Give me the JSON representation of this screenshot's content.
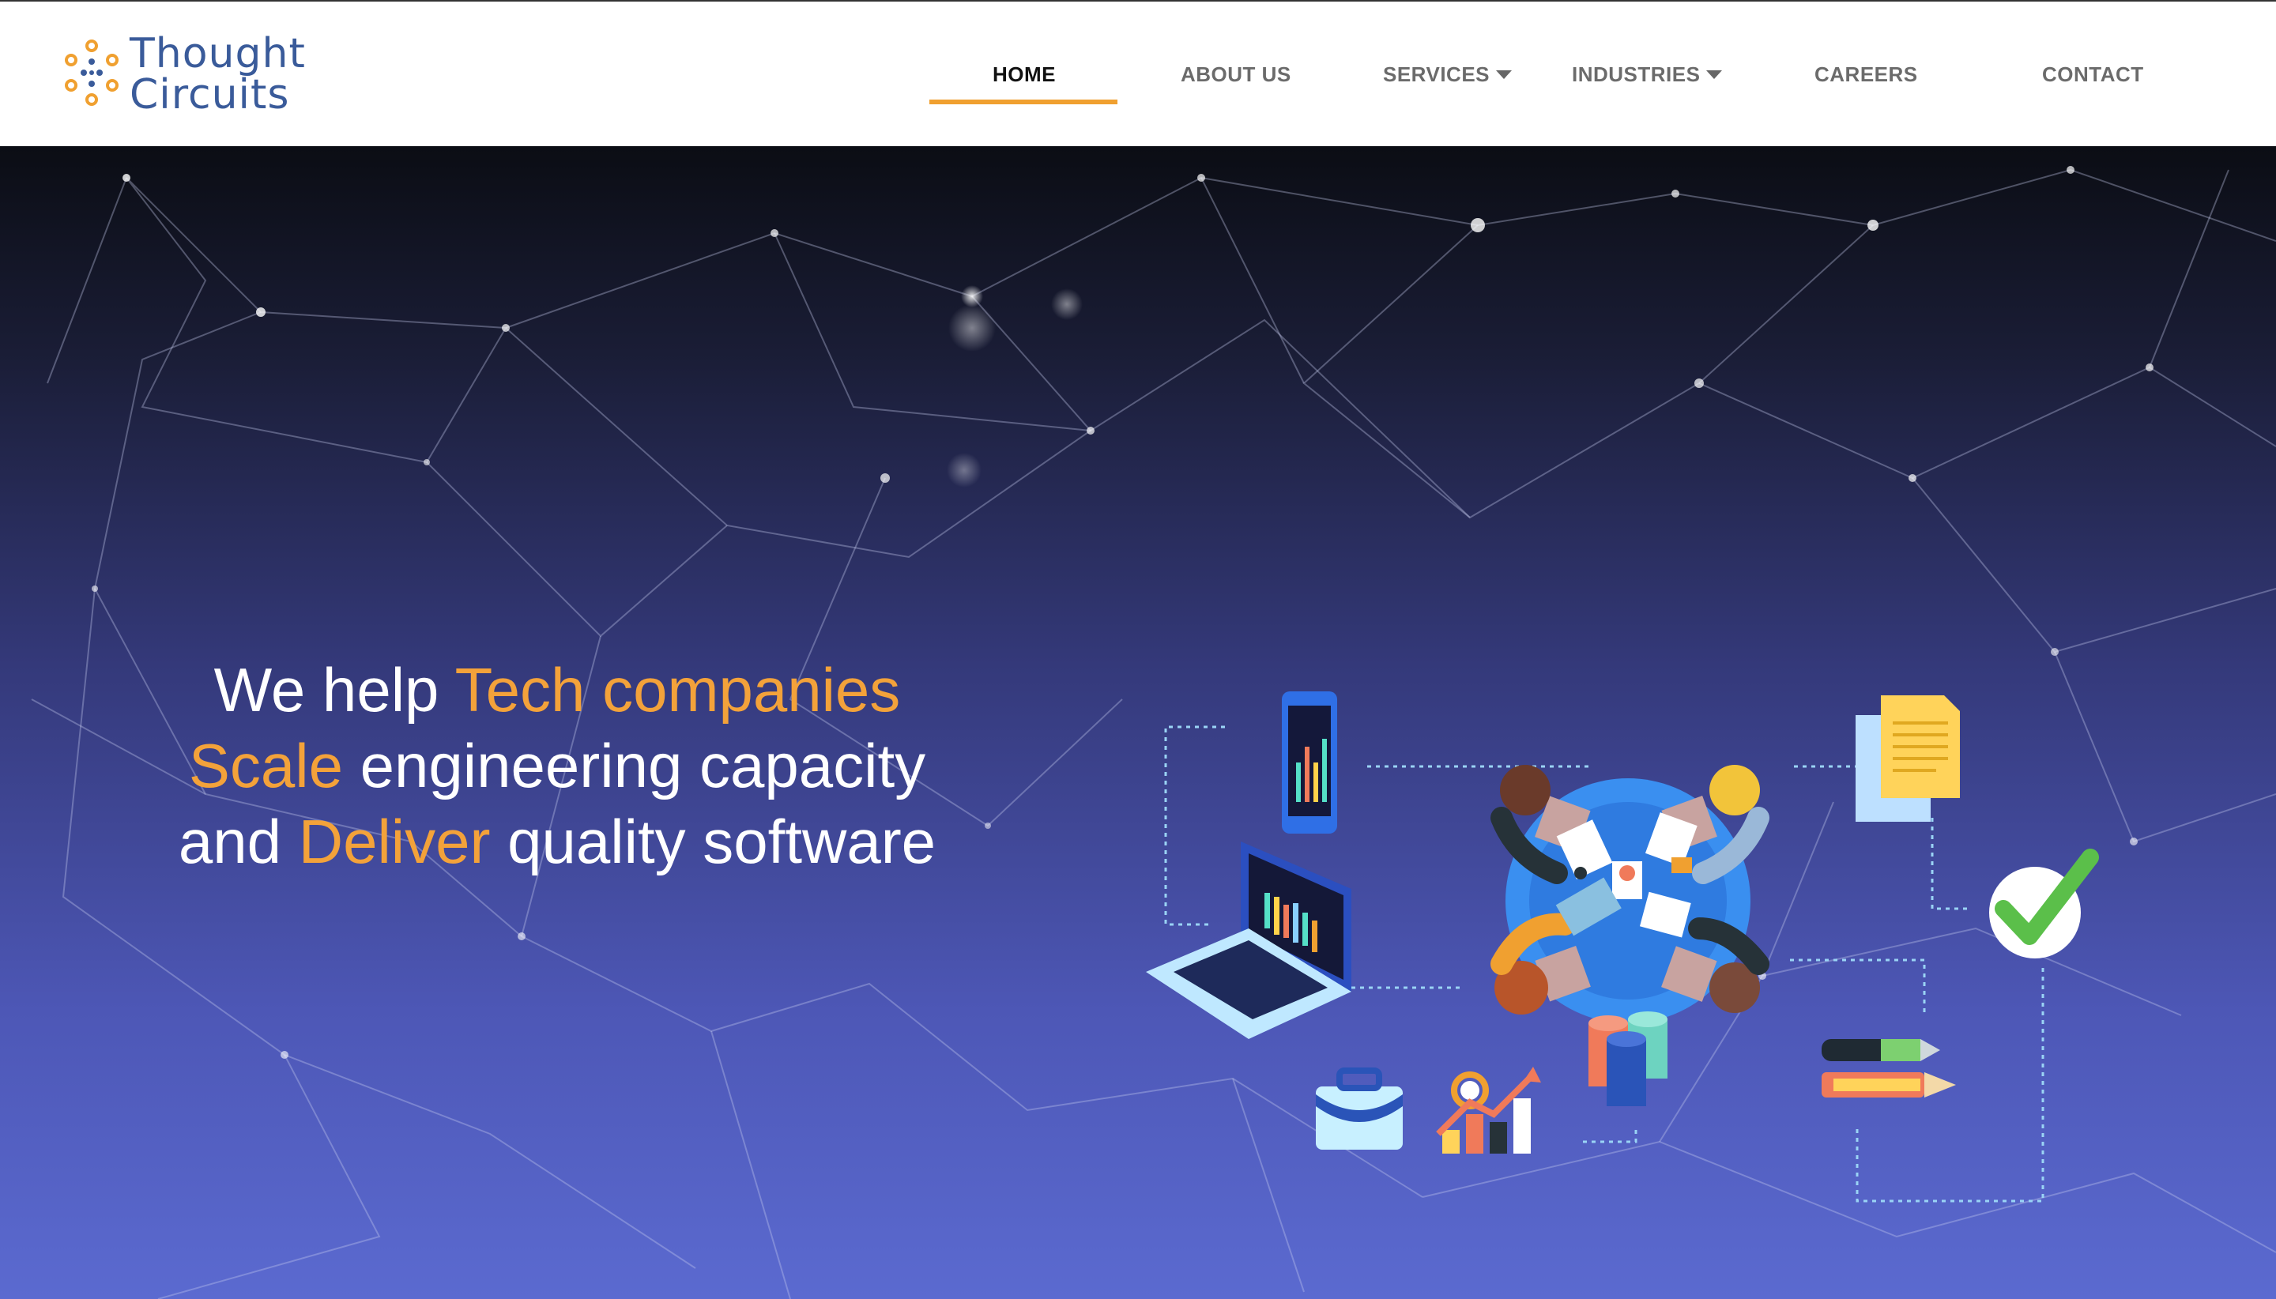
{
  "brand": {
    "name_line1": "Thought",
    "name_line2": "Circuits",
    "color_text": "#3a5b9a",
    "color_dots": "#f0a030"
  },
  "nav": {
    "items": [
      {
        "label": "HOME",
        "active": true,
        "dropdown": false
      },
      {
        "label": "ABOUT US",
        "active": false,
        "dropdown": false
      },
      {
        "label": "SERVICES",
        "active": false,
        "dropdown": true
      },
      {
        "label": "INDUSTRIES",
        "active": false,
        "dropdown": true
      },
      {
        "label": "CAREERS",
        "active": false,
        "dropdown": false
      },
      {
        "label": "CONTACT",
        "active": false,
        "dropdown": false
      }
    ],
    "active_color": "#f0a030"
  },
  "hero": {
    "line1_a": "We help ",
    "line1_b": "Tech companies",
    "line2_a": "Scale",
    "line2_b": " engineering capacity",
    "line3_a": "and ",
    "line3_b": "Deliver",
    "line3_c": " quality software",
    "accent_color": "#f3a23a",
    "illustration_icons": [
      "smartphone-chart-icon",
      "laptop-chart-icon",
      "team-meeting-table-icon",
      "documents-icon",
      "checkmark-icon",
      "pen-icon",
      "pencil-icon",
      "database-stack-icon",
      "briefcase-icon",
      "growth-chart-icon"
    ]
  }
}
